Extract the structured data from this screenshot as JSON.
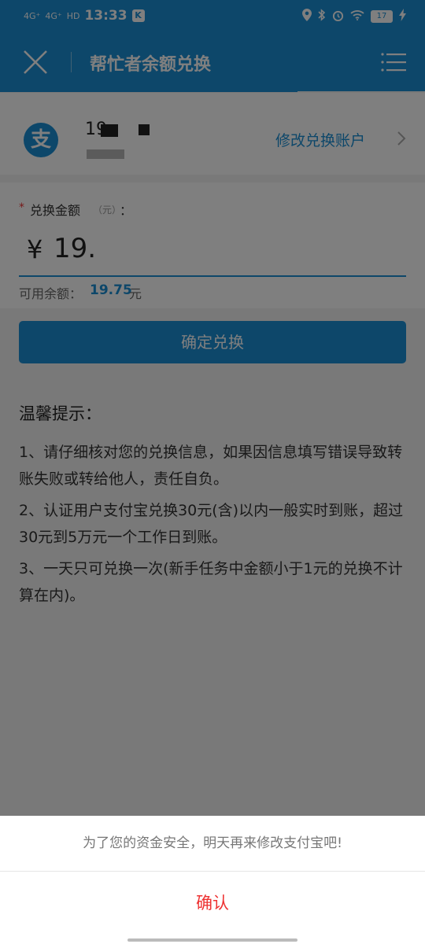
{
  "status_bar": {
    "signal1": "4G⁺",
    "signal2": "4G⁺",
    "hd": "HD",
    "time": "13:33",
    "app_badge": "K",
    "battery": "17"
  },
  "nav": {
    "title": "帮忙者余额兑换"
  },
  "account": {
    "number_visible": "19",
    "modify_label": "修改兑换账户"
  },
  "amount": {
    "required_mark": "*",
    "label": "兑换金额",
    "unit": "（元）",
    "colon": "：",
    "currency": "¥",
    "value": "19.",
    "available_label": "可用余额：",
    "available_value": "19.75",
    "available_unit": "元"
  },
  "confirm_button": "确定兑换",
  "tips": {
    "title": "温馨提示：",
    "items": [
      "1、请仔细核对您的兑换信息，如果因信息填写错误导致转账失败或转给他人，责任自负。",
      "2、认证用户支付宝兑换30元(含)以内一般实时到账，超过30元到5万元一个工作日到账。",
      "3、一天只可兑换一次(新手任务中金额小于1元的兑换不计算在内)。"
    ]
  },
  "dialog": {
    "message": "为了您的资金安全，明天再来修改支付宝吧!",
    "confirm": "确认"
  },
  "colors": {
    "primary": "#1a8ed4",
    "danger": "#e33333"
  }
}
